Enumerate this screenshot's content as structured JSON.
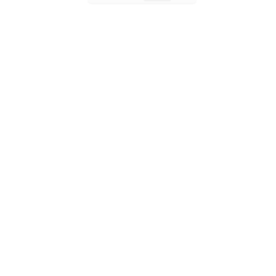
{
  "window": {
    "background": "#ffffff"
  },
  "top_bar": {
    "color": "#fbfbfb",
    "segment_color": "#f2f2f2"
  }
}
